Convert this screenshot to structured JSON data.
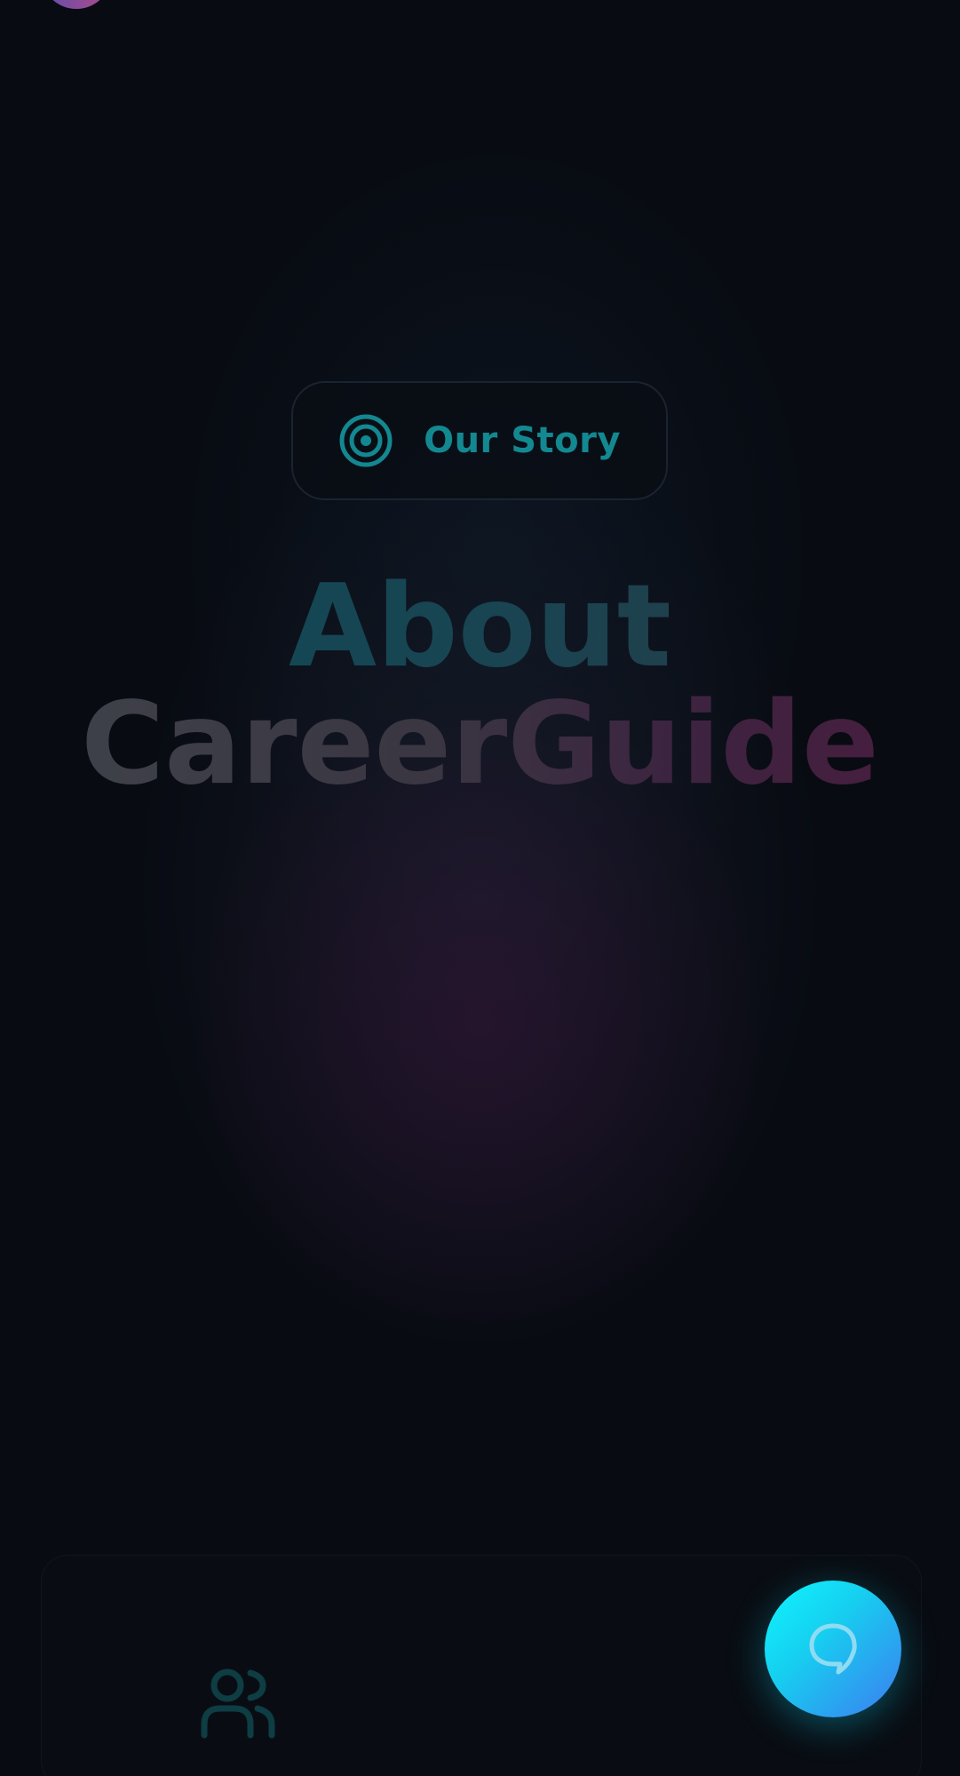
{
  "badge": {
    "icon": "target-icon",
    "label": "Our Story"
  },
  "hero": {
    "line1": "About",
    "line2": "CareerGuide"
  },
  "footer_card": {
    "icon": "users-icon"
  },
  "chat_button": {
    "icon": "chat-bubble-icon"
  },
  "colors": {
    "accent_cyan": "#138891",
    "fab_gradient_start": "#0ff6ff",
    "fab_gradient_end": "#3d7cf0",
    "background": "#080b12"
  }
}
